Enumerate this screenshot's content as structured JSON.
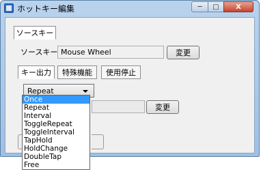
{
  "window": {
    "title": "ホットキー編集",
    "close_symbol": "X"
  },
  "source_tab": {
    "label": "ソースキー"
  },
  "source_key": {
    "label": "ソースキー",
    "value": "Mouse Wheel",
    "change_button": "変更"
  },
  "tabs": [
    {
      "label": "キー出力",
      "active": true
    },
    {
      "label": "特殊機能",
      "active": false
    },
    {
      "label": "使用停止",
      "active": false
    }
  ],
  "mode_select": {
    "selected": "Repeat",
    "options": [
      "Once",
      "Repeat",
      "Interval",
      "ToggleRepeat",
      "ToggleInterval",
      "TapHold",
      "HoldChange",
      "DoubleTap",
      "Free"
    ],
    "highlighted": "Once"
  },
  "output_key": {
    "change_button": "変更"
  }
}
